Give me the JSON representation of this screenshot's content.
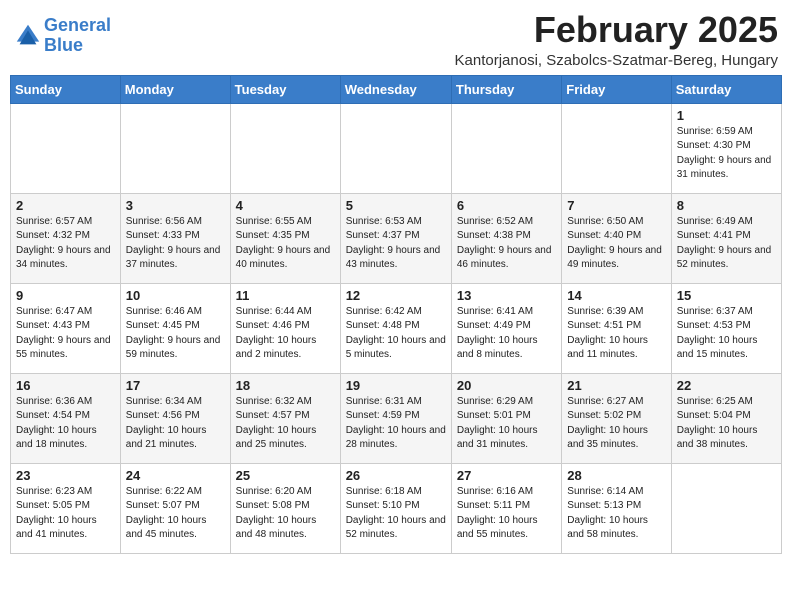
{
  "header": {
    "logo_line1": "General",
    "logo_line2": "Blue",
    "month_title": "February 2025",
    "location": "Kantorjanosi, Szabolcs-Szatmar-Bereg, Hungary"
  },
  "weekdays": [
    "Sunday",
    "Monday",
    "Tuesday",
    "Wednesday",
    "Thursday",
    "Friday",
    "Saturday"
  ],
  "weeks": [
    [
      {
        "day": "",
        "info": ""
      },
      {
        "day": "",
        "info": ""
      },
      {
        "day": "",
        "info": ""
      },
      {
        "day": "",
        "info": ""
      },
      {
        "day": "",
        "info": ""
      },
      {
        "day": "",
        "info": ""
      },
      {
        "day": "1",
        "info": "Sunrise: 6:59 AM\nSunset: 4:30 PM\nDaylight: 9 hours and 31 minutes."
      }
    ],
    [
      {
        "day": "2",
        "info": "Sunrise: 6:57 AM\nSunset: 4:32 PM\nDaylight: 9 hours and 34 minutes."
      },
      {
        "day": "3",
        "info": "Sunrise: 6:56 AM\nSunset: 4:33 PM\nDaylight: 9 hours and 37 minutes."
      },
      {
        "day": "4",
        "info": "Sunrise: 6:55 AM\nSunset: 4:35 PM\nDaylight: 9 hours and 40 minutes."
      },
      {
        "day": "5",
        "info": "Sunrise: 6:53 AM\nSunset: 4:37 PM\nDaylight: 9 hours and 43 minutes."
      },
      {
        "day": "6",
        "info": "Sunrise: 6:52 AM\nSunset: 4:38 PM\nDaylight: 9 hours and 46 minutes."
      },
      {
        "day": "7",
        "info": "Sunrise: 6:50 AM\nSunset: 4:40 PM\nDaylight: 9 hours and 49 minutes."
      },
      {
        "day": "8",
        "info": "Sunrise: 6:49 AM\nSunset: 4:41 PM\nDaylight: 9 hours and 52 minutes."
      }
    ],
    [
      {
        "day": "9",
        "info": "Sunrise: 6:47 AM\nSunset: 4:43 PM\nDaylight: 9 hours and 55 minutes."
      },
      {
        "day": "10",
        "info": "Sunrise: 6:46 AM\nSunset: 4:45 PM\nDaylight: 9 hours and 59 minutes."
      },
      {
        "day": "11",
        "info": "Sunrise: 6:44 AM\nSunset: 4:46 PM\nDaylight: 10 hours and 2 minutes."
      },
      {
        "day": "12",
        "info": "Sunrise: 6:42 AM\nSunset: 4:48 PM\nDaylight: 10 hours and 5 minutes."
      },
      {
        "day": "13",
        "info": "Sunrise: 6:41 AM\nSunset: 4:49 PM\nDaylight: 10 hours and 8 minutes."
      },
      {
        "day": "14",
        "info": "Sunrise: 6:39 AM\nSunset: 4:51 PM\nDaylight: 10 hours and 11 minutes."
      },
      {
        "day": "15",
        "info": "Sunrise: 6:37 AM\nSunset: 4:53 PM\nDaylight: 10 hours and 15 minutes."
      }
    ],
    [
      {
        "day": "16",
        "info": "Sunrise: 6:36 AM\nSunset: 4:54 PM\nDaylight: 10 hours and 18 minutes."
      },
      {
        "day": "17",
        "info": "Sunrise: 6:34 AM\nSunset: 4:56 PM\nDaylight: 10 hours and 21 minutes."
      },
      {
        "day": "18",
        "info": "Sunrise: 6:32 AM\nSunset: 4:57 PM\nDaylight: 10 hours and 25 minutes."
      },
      {
        "day": "19",
        "info": "Sunrise: 6:31 AM\nSunset: 4:59 PM\nDaylight: 10 hours and 28 minutes."
      },
      {
        "day": "20",
        "info": "Sunrise: 6:29 AM\nSunset: 5:01 PM\nDaylight: 10 hours and 31 minutes."
      },
      {
        "day": "21",
        "info": "Sunrise: 6:27 AM\nSunset: 5:02 PM\nDaylight: 10 hours and 35 minutes."
      },
      {
        "day": "22",
        "info": "Sunrise: 6:25 AM\nSunset: 5:04 PM\nDaylight: 10 hours and 38 minutes."
      }
    ],
    [
      {
        "day": "23",
        "info": "Sunrise: 6:23 AM\nSunset: 5:05 PM\nDaylight: 10 hours and 41 minutes."
      },
      {
        "day": "24",
        "info": "Sunrise: 6:22 AM\nSunset: 5:07 PM\nDaylight: 10 hours and 45 minutes."
      },
      {
        "day": "25",
        "info": "Sunrise: 6:20 AM\nSunset: 5:08 PM\nDaylight: 10 hours and 48 minutes."
      },
      {
        "day": "26",
        "info": "Sunrise: 6:18 AM\nSunset: 5:10 PM\nDaylight: 10 hours and 52 minutes."
      },
      {
        "day": "27",
        "info": "Sunrise: 6:16 AM\nSunset: 5:11 PM\nDaylight: 10 hours and 55 minutes."
      },
      {
        "day": "28",
        "info": "Sunrise: 6:14 AM\nSunset: 5:13 PM\nDaylight: 10 hours and 58 minutes."
      },
      {
        "day": "",
        "info": ""
      }
    ]
  ]
}
